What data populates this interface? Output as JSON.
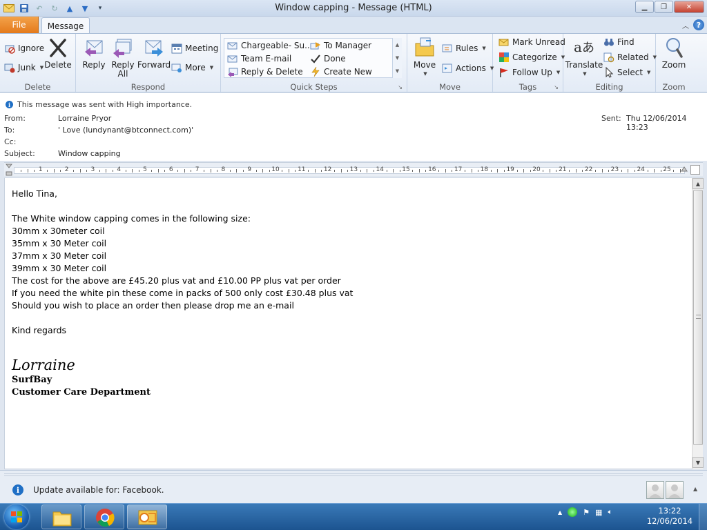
{
  "window": {
    "title": "Window capping  -  Message (HTML)"
  },
  "tabs": {
    "file": "File",
    "message": "Message"
  },
  "ribbon": {
    "delete_group": {
      "label": "Delete",
      "ignore": "Ignore",
      "junk": "Junk",
      "delete": "Delete"
    },
    "respond_group": {
      "label": "Respond",
      "reply": "Reply",
      "reply_all_1": "Reply",
      "reply_all_2": "All",
      "forward": "Forward",
      "meeting": "Meeting",
      "more": "More"
    },
    "quick_steps": {
      "label": "Quick Steps",
      "items": [
        "Chargeable- Su...",
        "To Manager",
        "Team E-mail",
        "Done",
        "Reply & Delete",
        "Create New"
      ]
    },
    "move_group": {
      "label": "Move",
      "move": "Move",
      "rules": "Rules",
      "actions": "Actions"
    },
    "tags_group": {
      "label": "Tags",
      "mark_unread": "Mark Unread",
      "categorize": "Categorize",
      "follow_up": "Follow Up"
    },
    "editing_group": {
      "label": "Editing",
      "translate": "Translate",
      "find": "Find",
      "related": "Related",
      "select": "Select"
    },
    "zoom_group": {
      "label": "Zoom",
      "zoom": "Zoom"
    }
  },
  "message": {
    "importance": "This message was sent with High importance.",
    "from_label": "From:",
    "from": "Lorraine Pryor",
    "to_label": "To:",
    "to": "' Love (lundynant@btconnect.com)'",
    "cc_label": "Cc:",
    "cc": "",
    "subject_label": "Subject:",
    "subject": "Window capping",
    "sent_label": "Sent:",
    "sent": "Thu 12/06/2014 13:23"
  },
  "ruler": {
    "numbers": [
      "1",
      "2",
      "3",
      "4",
      "5",
      "6",
      "7",
      "8",
      "9",
      "10",
      "11",
      "12",
      "13",
      "14",
      "15",
      "16",
      "17",
      "18",
      "19",
      "20",
      "21",
      "22",
      "23",
      "24",
      "25"
    ]
  },
  "body": {
    "greeting": "Hello Tina,",
    "lines": [
      "The White window capping comes in the following size:",
      "30mm x 30meter coil",
      "35mm x 30 Meter coil",
      "37mm x 30 Meter coil",
      "39mm x 30 Meter coil",
      "The cost for the above are  £45.20 plus vat and £10.00 PP plus vat per order",
      "If you need the white pin these come in packs of 500 only cost £30.48 plus vat",
      "Should you wish to place an order then please drop me an e-mail"
    ],
    "closing": "Kind regards",
    "signature_name": "Lorraine",
    "signature_company": "SurfBay",
    "signature_dept": "Customer Care Department"
  },
  "people_pane": {
    "update_text": "Update available for: Facebook."
  },
  "taskbar": {
    "time": "13:22",
    "date": "12/06/2014"
  },
  "colors": {
    "file_tab": "#e47a1b",
    "taskbar": "#1c5490",
    "accent": "#1f6fc5"
  }
}
